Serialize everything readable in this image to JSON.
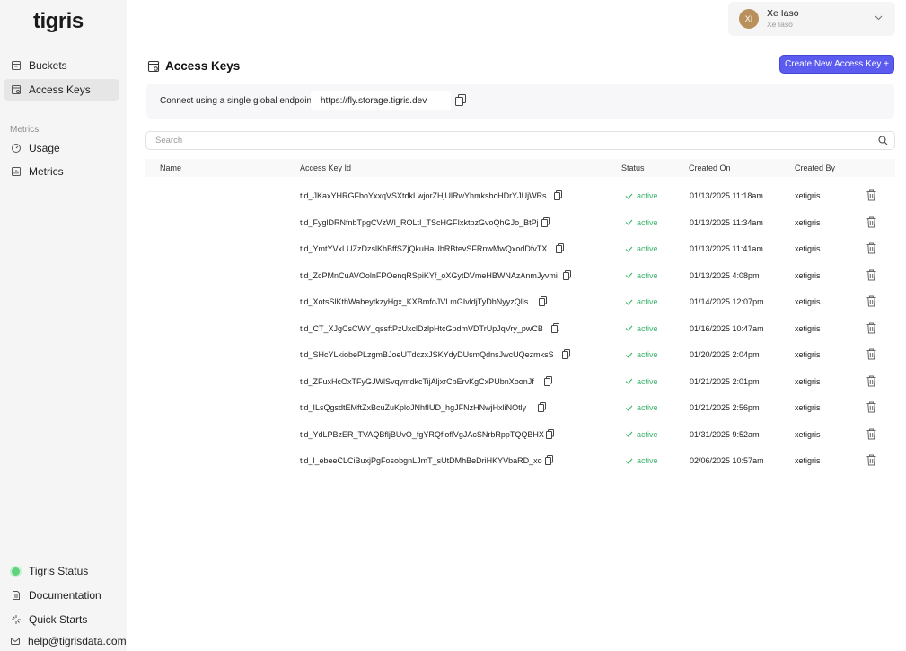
{
  "app": {
    "logo_text": "tigris"
  },
  "sidebar": {
    "items": [
      {
        "label": "Buckets",
        "icon": "bucket-icon"
      },
      {
        "label": "Access Keys",
        "icon": "key-card-icon"
      }
    ],
    "metrics_label": "Metrics",
    "metrics_items": [
      {
        "label": "Usage",
        "icon": "gauge-icon"
      },
      {
        "label": "Metrics",
        "icon": "chart-icon"
      }
    ],
    "footer_items": [
      {
        "label": "Tigris Status",
        "icon": "status-dot"
      },
      {
        "label": "Documentation",
        "icon": "document-icon"
      },
      {
        "label": "Quick Starts",
        "icon": "sparkle-icon"
      },
      {
        "label": "help@tigrisdata.com",
        "icon": "mail-icon"
      }
    ]
  },
  "user": {
    "initials": "XI",
    "name": "Xe Iaso",
    "subtitle": "Xe Iaso"
  },
  "page": {
    "title": "Access Keys",
    "create_button": "Create New Access Key +",
    "endpoint_label": "Connect using a single global endpoint:",
    "endpoint_value": "https://fly.storage.tigris.dev",
    "search_placeholder": "Search"
  },
  "table": {
    "columns": [
      "Name",
      "Access Key Id",
      "Status",
      "Created On",
      "Created By"
    ],
    "rows": [
      {
        "name": "",
        "id": "tid_JKaxYHRGFboYxxqVSXtdkLwjorZHjUlRwYhmksbcHDrYJUjWRs",
        "status": "active",
        "created_on": "01/13/2025 11:18am",
        "created_by": "xetigris"
      },
      {
        "name": "",
        "id": "tid_FyglDRNfnbTpgCVzWI_ROLtI_TScHGFIxktpzGvoQhGJo_BtPj",
        "status": "active",
        "created_on": "01/13/2025 11:34am",
        "created_by": "xetigris"
      },
      {
        "name": "",
        "id": "tid_YmtYVxLUZzDzslKbBffSZjQkuHaUbRBtevSFRnwMwQxodDfvTX",
        "status": "active",
        "created_on": "01/13/2025 11:41am",
        "created_by": "xetigris"
      },
      {
        "name": "",
        "id": "tid_ZcPMnCuAVOolnFPOenqRSpiKYf_oXGytDVmeHBWNAzAnmJyvmi",
        "status": "active",
        "created_on": "01/13/2025 4:08pm",
        "created_by": "xetigris"
      },
      {
        "name": "",
        "id": "tid_XotsSlKthWabeytkzyHgx_KXBmfoJVLmGIvldjTyDbNyyzQlls",
        "status": "active",
        "created_on": "01/14/2025 12:07pm",
        "created_by": "xetigris"
      },
      {
        "name": "",
        "id": "tid_CT_XJgCsCWY_qssftPzUxclDzlpHtcGpdmVDTrUpJqVry_pwCB",
        "status": "active",
        "created_on": "01/16/2025 10:47am",
        "created_by": "xetigris"
      },
      {
        "name": "",
        "id": "tid_SHcYLkiobePLzgmBJoeUTdczxJSKYdyDUsmQdnsJwcUQezmksS",
        "status": "active",
        "created_on": "01/20/2025 2:04pm",
        "created_by": "xetigris"
      },
      {
        "name": "",
        "id": "tid_ZFuxHcOxTFyGJWlSvqymdkcTijAljxrCbErvKgCxPUbnXoonJf",
        "status": "active",
        "created_on": "01/21/2025 2:01pm",
        "created_by": "xetigris"
      },
      {
        "name": "",
        "id": "tid_ILsQgsdtEMftZxBcuZuKploJNhfIUD_hgJFNzHNwjHxliNOtly",
        "status": "active",
        "created_on": "01/21/2025 2:56pm",
        "created_by": "xetigris"
      },
      {
        "name": "",
        "id": "tid_YdLPBzER_TVAQBfljBUvO_fgYRQfioflVgJAcSNrbRppTQQBHX",
        "status": "active",
        "created_on": "01/31/2025 9:52am",
        "created_by": "xetigris"
      },
      {
        "name": "",
        "id": "tid_l_ebeeCLCiBuxjPgFosobgnLJmT_sUtDMhBeDriHKYVbaRD_xo",
        "status": "active",
        "created_on": "02/06/2025 10:57am",
        "created_by": "xetigris"
      }
    ]
  },
  "colors": {
    "accent": "#5b5bf0",
    "status_active": "#3bb46a",
    "status_dot": "#5fd37d"
  }
}
